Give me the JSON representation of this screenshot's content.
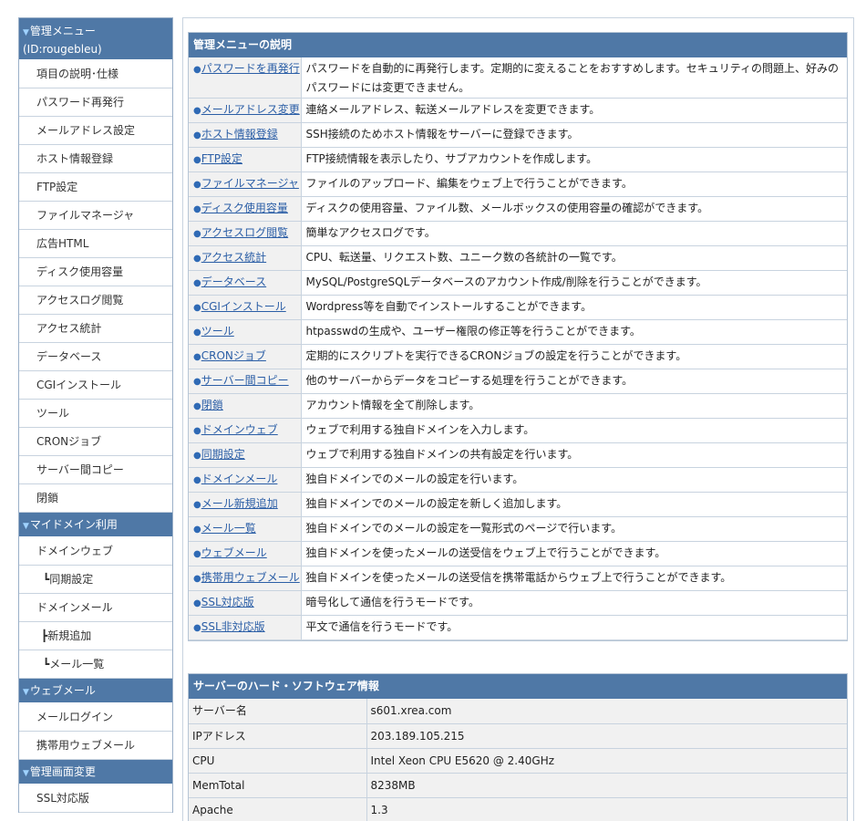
{
  "sidebar": {
    "header_main_line1": "管理メニュー",
    "header_main_line2": "(ID:rougebleu)",
    "main_items": [
      "項目の説明･仕様",
      "パスワード再発行",
      "メールアドレス設定",
      "ホスト情報登録",
      "FTP設定",
      "ファイルマネージャ",
      "広告HTML",
      "ディスク使用容量",
      "アクセスログ閲覧",
      "アクセス統計",
      "データベース",
      "CGIインストール",
      "ツール",
      "CRONジョブ",
      "サーバー間コピー",
      "閉鎖"
    ],
    "header_domain": "マイドメイン利用",
    "domain_items": [
      "ドメインウェブ",
      "┗同期設定",
      "ドメインメール",
      "┣新規追加",
      "┗メール一覧"
    ],
    "header_webmail": "ウェブメール",
    "webmail_items": [
      "メールログイン",
      "携帯用ウェブメール"
    ],
    "header_admin": "管理画面変更",
    "admin_items": [
      "SSL対応版"
    ]
  },
  "menu_panel": {
    "title": "管理メニューの説明",
    "rows": [
      {
        "name": "パスワードを再発行",
        "desc": "パスワードを自動的に再発行します。定期的に変えることをおすすめします。セキュリティの問題上、好みのパスワードには変更できません。"
      },
      {
        "name": "メールアドレス変更",
        "desc": "連絡メールアドレス、転送メールアドレスを変更できます。"
      },
      {
        "name": "ホスト情報登録",
        "desc": "SSH接続のためホスト情報をサーバーに登録できます。"
      },
      {
        "name": "FTP設定",
        "desc": "FTP接続情報を表示したり、サブアカウントを作成します。"
      },
      {
        "name": "ファイルマネージャ",
        "desc": "ファイルのアップロード、編集をウェブ上で行うことができます。"
      },
      {
        "name": "ディスク使用容量",
        "desc": "ディスクの使用容量、ファイル数、メールボックスの使用容量の確認ができます。"
      },
      {
        "name": "アクセスログ閲覧",
        "desc": "簡単なアクセスログです。"
      },
      {
        "name": "アクセス統計",
        "desc": "CPU、転送量、リクエスト数、ユニーク数の各統計の一覧です。"
      },
      {
        "name": "データベース",
        "desc": "MySQL/PostgreSQLデータベースのアカウント作成/削除を行うことができます。"
      },
      {
        "name": "CGIインストール",
        "desc": "Wordpress等を自動でインストールすることができます。"
      },
      {
        "name": "ツール",
        "desc": "htpasswdの生成や、ユーザー権限の修正等を行うことができます。"
      },
      {
        "name": "CRONジョブ",
        "desc": "定期的にスクリプトを実行できるCRONジョブの設定を行うことができます。"
      },
      {
        "name": "サーバー間コピー",
        "desc": "他のサーバーからデータをコピーする処理を行うことができます。"
      },
      {
        "name": "閉鎖",
        "desc": "アカウント情報を全て削除します。"
      },
      {
        "name": "ドメインウェブ",
        "desc": "ウェブで利用する独自ドメインを入力します。"
      },
      {
        "name": "同期設定",
        "desc": "ウェブで利用する独自ドメインの共有設定を行います。"
      },
      {
        "name": "ドメインメール",
        "desc": "独自ドメインでのメールの設定を行います。"
      },
      {
        "name": "メール新規追加",
        "desc": "独自ドメインでのメールの設定を新しく追加します。"
      },
      {
        "name": "メール一覧",
        "desc": "独自ドメインでのメールの設定を一覧形式のページで行います。"
      },
      {
        "name": "ウェブメール",
        "desc": "独自ドメインを使ったメールの送受信をウェブ上で行うことができます。"
      },
      {
        "name": "携帯用ウェブメール",
        "desc": "独自ドメインを使ったメールの送受信を携帯電話からウェブ上で行うことができます。"
      },
      {
        "name": "SSL対応版",
        "desc": "暗号化して通信を行うモードです。"
      },
      {
        "name": "SSL非対応版",
        "desc": "平文で通信を行うモードです。"
      }
    ]
  },
  "server_panel": {
    "title": "サーバーのハード・ソフトウェア情報",
    "rows": [
      {
        "label": "サーバー名",
        "value": "s601.xrea.com"
      },
      {
        "label": "IPアドレス",
        "value": "203.189.105.215"
      },
      {
        "label": "CPU",
        "value": "Intel Xeon CPU E5620 @ 2.40GHz"
      },
      {
        "label": "MemTotal",
        "value": "8238MB"
      },
      {
        "label": "Apache",
        "value": "1.3"
      }
    ]
  },
  "bullet_glyph": "●",
  "header_arrow_glyph": "▼",
  "colors": {
    "header_bg": "#4f78a6",
    "link": "#2b5ea6",
    "bullet": "#2f6ab5"
  }
}
